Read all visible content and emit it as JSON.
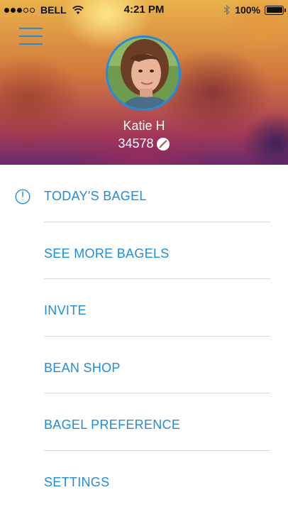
{
  "status_bar": {
    "carrier": "BELL",
    "time": "4:21 PM",
    "battery": "100%",
    "signal_full_bars": 3,
    "signal_total_bars": 5
  },
  "profile": {
    "name": "Katie H",
    "bean_count": "34578"
  },
  "menu": {
    "items": [
      {
        "label": "TODAY'S BAGEL",
        "icon": "clock-icon"
      },
      {
        "label": "SEE MORE BAGELS"
      },
      {
        "label": "INVITE"
      },
      {
        "label": "BEAN SHOP"
      },
      {
        "label": "BAGEL PREFERENCE"
      },
      {
        "label": "SETTINGS"
      }
    ]
  },
  "colors": {
    "accent": "#1e8ce0",
    "divider": "#d9d9d9",
    "background": "#ffffff"
  }
}
